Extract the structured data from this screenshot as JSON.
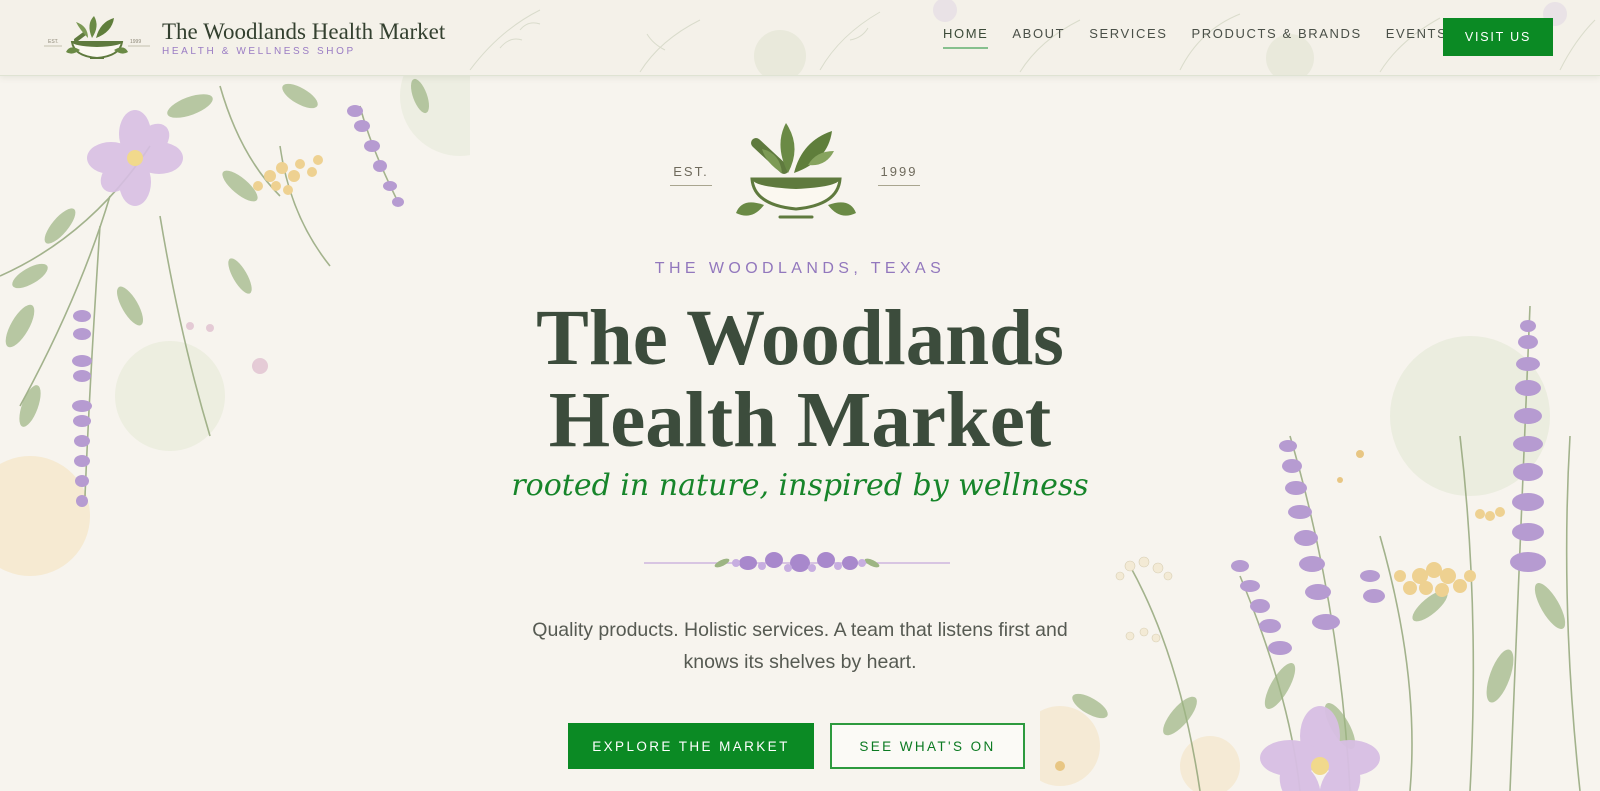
{
  "header": {
    "brand_name": "The Woodlands Health Market",
    "brand_tagline": "HEALTH & WELLNESS SHOP",
    "logo": {
      "est": "EST.",
      "year": "1999"
    },
    "nav": [
      {
        "label": "HOME",
        "active": true
      },
      {
        "label": "ABOUT",
        "active": false
      },
      {
        "label": "SERVICES",
        "active": false
      },
      {
        "label": "PRODUCTS & BRANDS",
        "active": false
      },
      {
        "label": "EVENTS",
        "active": false
      }
    ],
    "cta_label": "VISIT US"
  },
  "hero": {
    "emblem": {
      "est": "EST.",
      "year": "1999",
      "icon": "mortar-pestle-leaf-icon"
    },
    "location": "THE WOODLANDS, TEXAS",
    "title_line1": "The Woodlands",
    "title_line2": "Health Market",
    "tagline": "rooted in nature, inspired by wellness",
    "description_line1": "Quality products. Holistic services. A team that listens first and",
    "description_line2": "knows its shelves by heart.",
    "primary_button": "EXPLORE THE MARKET",
    "secondary_button": "SEE WHAT'S ON"
  },
  "colors": {
    "brand_green": "#0b8a24",
    "accent_purple": "#9277bd",
    "background": "#f7f4ee",
    "heading": "#3c4c3c"
  }
}
